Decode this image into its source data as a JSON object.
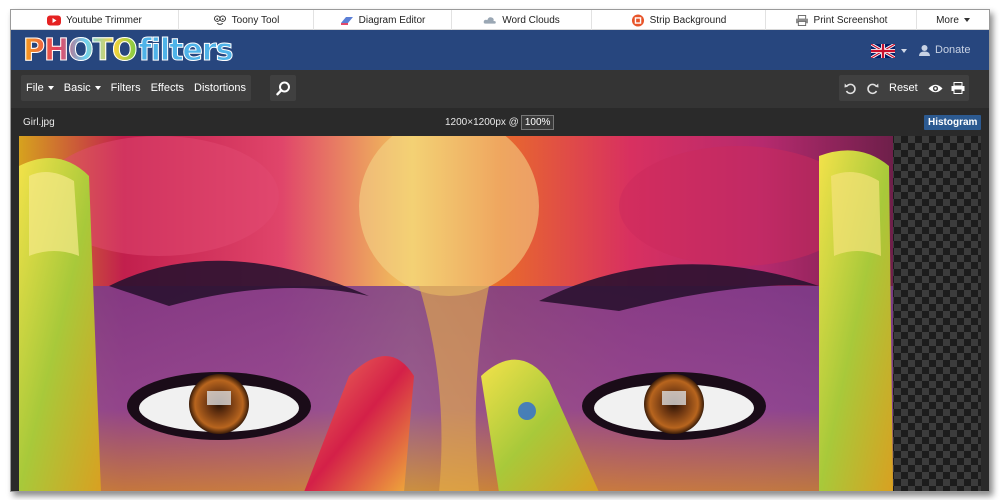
{
  "toplinks": [
    {
      "label": "Youtube Trimmer",
      "icon": "youtube-icon"
    },
    {
      "label": "Toony Tool",
      "icon": "toony-face-icon"
    },
    {
      "label": "Diagram Editor",
      "icon": "diagram-icon"
    },
    {
      "label": "Word Clouds",
      "icon": "cloud-icon"
    },
    {
      "label": "Strip Background",
      "icon": "strip-background-icon"
    },
    {
      "label": "Print Screenshot",
      "icon": "printer-icon"
    },
    {
      "label": "More",
      "icon": "chevron-down-icon"
    }
  ],
  "header": {
    "logo_photo": "PHOTO",
    "logo_filters": "filters",
    "language_flag": "uk-flag-icon",
    "donate_label": "Donate",
    "background_color": "#27467e"
  },
  "toolbar": {
    "menu": [
      {
        "label": "File",
        "dropdown": true
      },
      {
        "label": "Basic",
        "dropdown": true
      },
      {
        "label": "Filters",
        "dropdown": false
      },
      {
        "label": "Effects",
        "dropdown": false
      },
      {
        "label": "Distortions",
        "dropdown": false
      }
    ],
    "reset_label": "Reset",
    "icons": [
      "search-icon",
      "undo-icon",
      "redo-icon",
      "eye-icon",
      "print-icon"
    ]
  },
  "infobar": {
    "filename": "Girl.jpg",
    "dimensions": "1200×1200px @",
    "zoom": "100%",
    "histogram_label": "Histogram",
    "histogram_color": "#2c5a91"
  },
  "canvas": {
    "image_subject": "close-up of face covered in colorful paint with brown eyes and painted fingers",
    "transparent_checker": true
  }
}
